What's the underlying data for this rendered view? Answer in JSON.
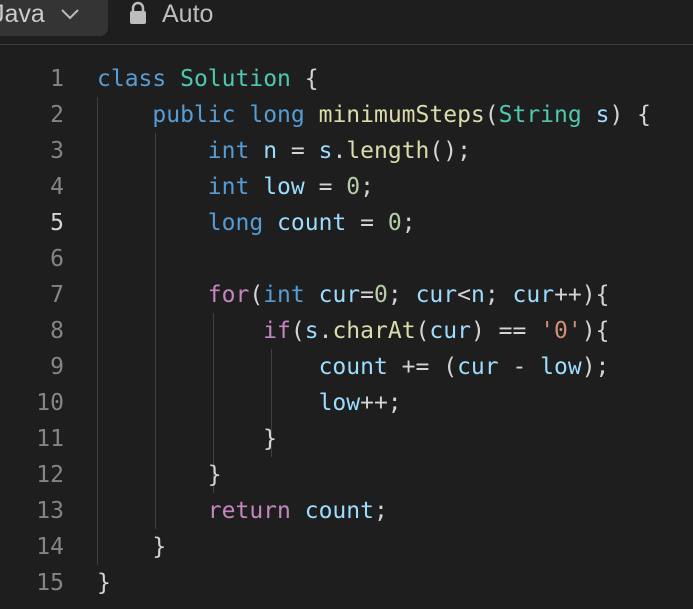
{
  "toolbar": {
    "language": "Java",
    "mode": "Auto",
    "icons": [
      "chevron-down-icon",
      "lock-icon"
    ]
  },
  "editor": {
    "active_line": 5,
    "lines": [
      {
        "n": "1",
        "tokens": [
          [
            "kw",
            "class"
          ],
          [
            "pl",
            " "
          ],
          [
            "ty",
            "Solution"
          ],
          [
            "pl",
            " {"
          ]
        ]
      },
      {
        "n": "2",
        "tokens": [
          [
            "pl",
            "    "
          ],
          [
            "kw",
            "public"
          ],
          [
            "pl",
            " "
          ],
          [
            "kw",
            "long"
          ],
          [
            "pl",
            " "
          ],
          [
            "fn",
            "minimumSteps"
          ],
          [
            "pl",
            "("
          ],
          [
            "ty",
            "String"
          ],
          [
            "pl",
            " "
          ],
          [
            "vr",
            "s"
          ],
          [
            "pl",
            ") {"
          ]
        ]
      },
      {
        "n": "3",
        "tokens": [
          [
            "pl",
            "        "
          ],
          [
            "kw",
            "int"
          ],
          [
            "pl",
            " "
          ],
          [
            "vr",
            "n"
          ],
          [
            "pl",
            " = "
          ],
          [
            "vr",
            "s"
          ],
          [
            "pl",
            "."
          ],
          [
            "fn",
            "length"
          ],
          [
            "pl",
            "();"
          ]
        ]
      },
      {
        "n": "4",
        "tokens": [
          [
            "pl",
            "        "
          ],
          [
            "kw",
            "int"
          ],
          [
            "pl",
            " "
          ],
          [
            "vr",
            "low"
          ],
          [
            "pl",
            " = "
          ],
          [
            "nm",
            "0"
          ],
          [
            "pl",
            ";"
          ]
        ]
      },
      {
        "n": "5",
        "tokens": [
          [
            "pl",
            "        "
          ],
          [
            "kw",
            "long"
          ],
          [
            "pl",
            " "
          ],
          [
            "vr",
            "count"
          ],
          [
            "pl",
            " = "
          ],
          [
            "nm",
            "0"
          ],
          [
            "pl",
            ";"
          ]
        ]
      },
      {
        "n": "6",
        "tokens": []
      },
      {
        "n": "7",
        "tokens": [
          [
            "pl",
            "        "
          ],
          [
            "ctl",
            "for"
          ],
          [
            "pl",
            "("
          ],
          [
            "kw",
            "int"
          ],
          [
            "pl",
            " "
          ],
          [
            "vr",
            "cur"
          ],
          [
            "pl",
            "="
          ],
          [
            "nm",
            "0"
          ],
          [
            "pl",
            "; "
          ],
          [
            "vr",
            "cur"
          ],
          [
            "pl",
            "<"
          ],
          [
            "vr",
            "n"
          ],
          [
            "pl",
            "; "
          ],
          [
            "vr",
            "cur"
          ],
          [
            "pl",
            "++){"
          ]
        ]
      },
      {
        "n": "8",
        "tokens": [
          [
            "pl",
            "            "
          ],
          [
            "ctl",
            "if"
          ],
          [
            "pl",
            "("
          ],
          [
            "vr",
            "s"
          ],
          [
            "pl",
            "."
          ],
          [
            "fn",
            "charAt"
          ],
          [
            "pl",
            "("
          ],
          [
            "vr",
            "cur"
          ],
          [
            "pl",
            ") == "
          ],
          [
            "str",
            "'0'"
          ],
          [
            "pl",
            "){"
          ]
        ]
      },
      {
        "n": "9",
        "tokens": [
          [
            "pl",
            "                "
          ],
          [
            "vr",
            "count"
          ],
          [
            "pl",
            " += ("
          ],
          [
            "vr",
            "cur"
          ],
          [
            "pl",
            " - "
          ],
          [
            "vr",
            "low"
          ],
          [
            "pl",
            ");"
          ]
        ]
      },
      {
        "n": "10",
        "tokens": [
          [
            "pl",
            "                "
          ],
          [
            "vr",
            "low"
          ],
          [
            "pl",
            "++;"
          ]
        ]
      },
      {
        "n": "11",
        "tokens": [
          [
            "pl",
            "            }"
          ]
        ]
      },
      {
        "n": "12",
        "tokens": [
          [
            "pl",
            "        }"
          ]
        ]
      },
      {
        "n": "13",
        "tokens": [
          [
            "pl",
            "        "
          ],
          [
            "ctl",
            "return"
          ],
          [
            "pl",
            " "
          ],
          [
            "vr",
            "count"
          ],
          [
            "pl",
            ";"
          ]
        ]
      },
      {
        "n": "14",
        "tokens": [
          [
            "pl",
            "    }"
          ]
        ]
      },
      {
        "n": "15",
        "tokens": [
          [
            "pl",
            "}"
          ]
        ]
      }
    ]
  }
}
